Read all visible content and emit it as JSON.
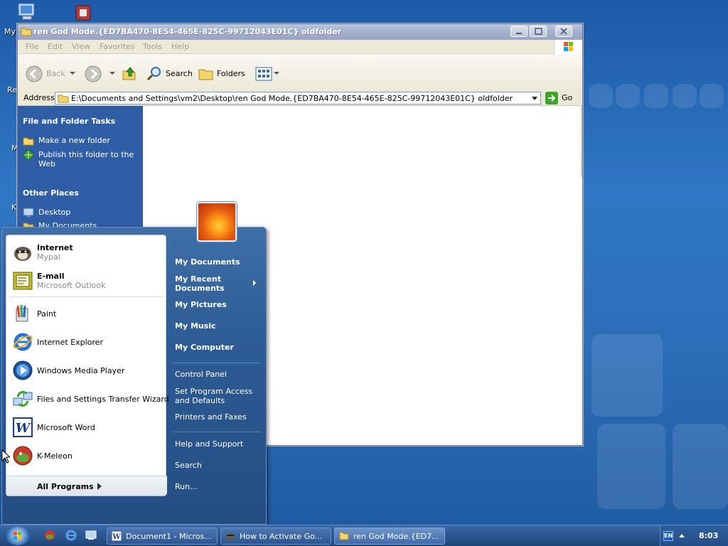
{
  "desktop": {
    "labels": [
      "My",
      "Re",
      "M",
      "K"
    ]
  },
  "explorer": {
    "title": "ren God Mode.{ED7BA470-8E54-465E-825C-99712043E01C} oldfolder",
    "menu": [
      "File",
      "Edit",
      "View",
      "Favorites",
      "Tools",
      "Help"
    ],
    "toolbar": {
      "back": "Back",
      "search": "Search",
      "folders": "Folders"
    },
    "address": {
      "label": "Address",
      "value": "E:\\Documents and Settings\\vm2\\Desktop\\ren God Mode.{ED7BA470-8E54-465E-825C-99712043E01C} oldfolder",
      "go": "Go"
    },
    "taskpane": {
      "file_tasks_heading": "File and Folder Tasks",
      "make_folder": "Make a new folder",
      "publish": "Publish this folder to the Web",
      "other_places_heading": "Other Places",
      "desktop": "Desktop",
      "my_documents": "My Documents"
    }
  },
  "start_menu": {
    "pinned": [
      {
        "name": "Internet",
        "sub": "Mypal"
      },
      {
        "name": "E-mail",
        "sub": "Microsoft Outlook"
      }
    ],
    "recent": [
      {
        "name": "Paint"
      },
      {
        "name": "Internet Explorer"
      },
      {
        "name": "Windows Media Player"
      },
      {
        "name": "Files and Settings Transfer Wizard"
      },
      {
        "name": "Microsoft Word"
      },
      {
        "name": "K-Meleon"
      }
    ],
    "all_programs": "All Programs",
    "right": {
      "my_documents": "My Documents",
      "my_recent_documents": "My Recent Documents",
      "my_pictures": "My Pictures",
      "my_music": "My Music",
      "my_computer": "My Computer",
      "control_panel": "Control Panel",
      "set_program_access": "Set Program Access and Defaults",
      "printers_faxes": "Printers and Faxes",
      "help_support": "Help and Support",
      "search": "Search",
      "run": "Run..."
    }
  },
  "taskbar": {
    "tasks": [
      {
        "label": "Document1 - Micros..."
      },
      {
        "label": "How to Activate Go..."
      },
      {
        "label": "ren God Mode.{ED7..."
      }
    ],
    "lang": "EN",
    "clock": "8:03"
  }
}
